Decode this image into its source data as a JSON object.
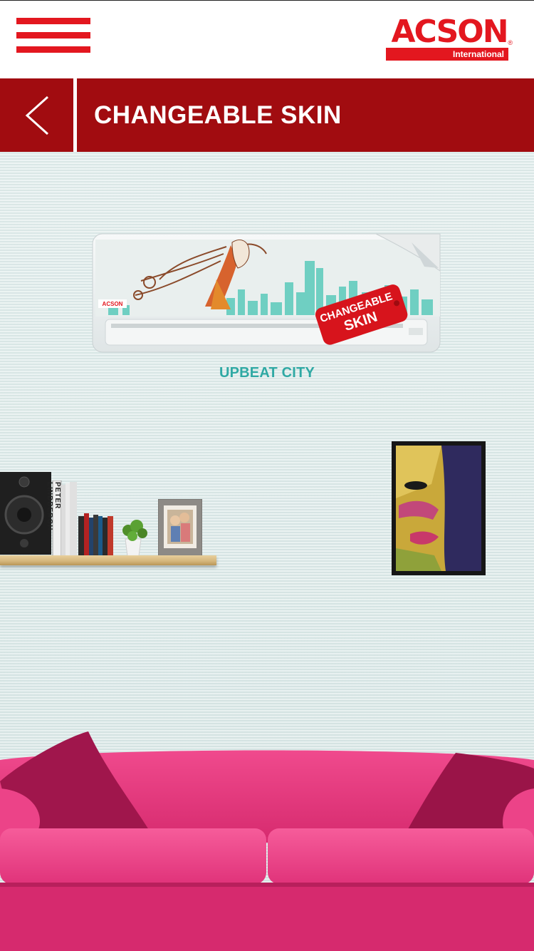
{
  "header": {
    "menu_icon": "hamburger-menu-icon",
    "logo": {
      "brand": "ACSON",
      "subtitle": "International",
      "registered": "®"
    }
  },
  "titlebar": {
    "back_icon": "chevron-left-icon",
    "title": "CHANGEABLE SKIN"
  },
  "product": {
    "tag_line1": "CHANGEABLE",
    "tag_line2": "SKIN",
    "unit_brand": "ACSON",
    "skin_name": "UPBEAT CITY"
  },
  "decor": {
    "book_spine": "PETER LINDBERGH"
  },
  "colors": {
    "brand_red": "#e3171f",
    "title_bar": "#a10c10",
    "wall": "#dfeceb",
    "skin_label": "#2fa9a4",
    "sofa": "#e8337b"
  }
}
